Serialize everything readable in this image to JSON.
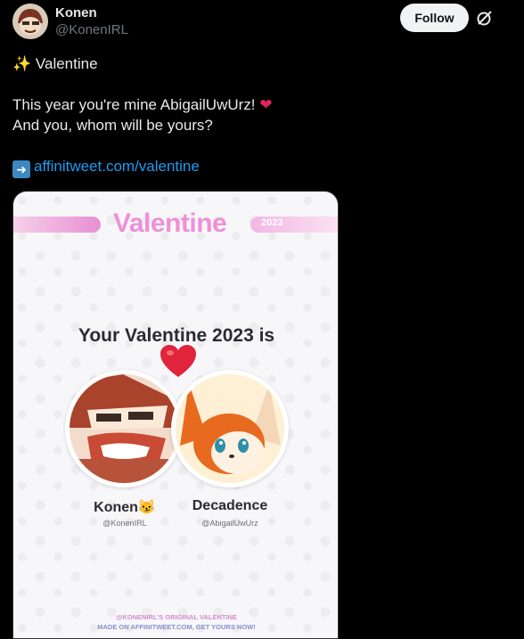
{
  "author": {
    "name": "Konen",
    "handle": "@KonenIRL"
  },
  "follow_label": "Follow",
  "tweet": {
    "line1": "Valentine",
    "line2": "This year you're mine AbigailUwUrz!",
    "line3": "And you, whom will be yours?",
    "link": "affinitweet.com/valentine"
  },
  "card": {
    "banner_title": "Valentine",
    "banner_year": "2023",
    "subtitle": "Your Valentine 2023 is",
    "left": {
      "name": "Konen",
      "handle": "@KonenIRL"
    },
    "right": {
      "name": "Decadence",
      "handle": "@AbigailUwUrz"
    },
    "footer_line1": "@KONENIRL'S ORIGINAL VALENTINE",
    "footer_line2": "MADE ON AFFINITWEET.COM, GET YOURS NOW!"
  },
  "icons": {
    "avatar": "profile-avatar",
    "grok": "grok-icon",
    "sparkles": "sparkles-icon",
    "heart": "red-heart-icon",
    "arrow": "right-arrow-icon",
    "cat": "cat-face-icon"
  },
  "colors": {
    "background": "#000000",
    "link": "#1d9bf0",
    "follow_bg": "#eff3f4",
    "banner_pink": "#ee8fd8",
    "heart": "#e0245e"
  }
}
